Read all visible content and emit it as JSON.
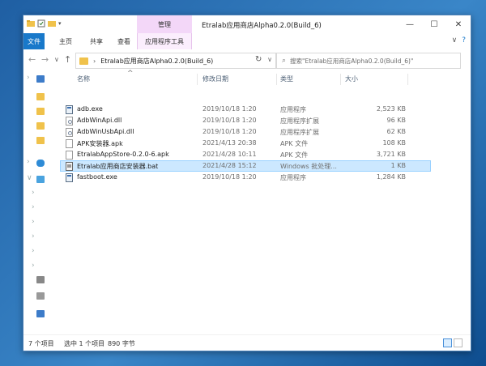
{
  "window": {
    "title": "Etralab应用商店Alpha0.2.0(Build_6)",
    "context_tab": "管理",
    "controls": {
      "minimize": "—",
      "maximize": "☐",
      "close": "✕"
    }
  },
  "ribbon": {
    "tabs": [
      "文件",
      "主页",
      "共享",
      "查看",
      "应用程序工具"
    ],
    "help": "?"
  },
  "address": {
    "path": "Etralab应用商店Alpha0.2.0(Build_6)",
    "chevron": "›",
    "search_placeholder": "搜索\"Etralab应用商店Alpha0.2.0(Build_6)\""
  },
  "columns": {
    "name": "名称",
    "date": "修改日期",
    "type": "类型",
    "size": "大小"
  },
  "files": [
    {
      "name": "adb.exe",
      "date": "2019/10/18 1:20",
      "type": "应用程序",
      "size": "2,523 KB",
      "icon": "exe-icon"
    },
    {
      "name": "AdbWinApi.dll",
      "date": "2019/10/18 1:20",
      "type": "应用程序扩展",
      "size": "96 KB",
      "icon": "dll-icon"
    },
    {
      "name": "AdbWinUsbApi.dll",
      "date": "2019/10/18 1:20",
      "type": "应用程序扩展",
      "size": "62 KB",
      "icon": "dll-icon"
    },
    {
      "name": "APK安装器.apk",
      "date": "2021/4/13 20:38",
      "type": "APK 文件",
      "size": "108 KB",
      "icon": "file-icon"
    },
    {
      "name": "EtralabAppStore-0.2.0-6.apk",
      "date": "2021/4/28 10:11",
      "type": "APK 文件",
      "size": "3,721 KB",
      "icon": "file-icon"
    },
    {
      "name": "Etralab应用商店安装器.bat",
      "date": "2021/4/28 15:12",
      "type": "Windows 批处理...",
      "size": "1 KB",
      "icon": "bat-icon",
      "selected": true
    },
    {
      "name": "fastboot.exe",
      "date": "2019/10/18 1:20",
      "type": "应用程序",
      "size": "1,284 KB",
      "icon": "exe-icon"
    }
  ],
  "status": {
    "count": "7 个项目",
    "selection": "选中 1 个项目",
    "size": "890 字节"
  },
  "colors": {
    "accent": "#1979ca",
    "context": "#f3d7f8",
    "selection": "#cce8ff"
  }
}
